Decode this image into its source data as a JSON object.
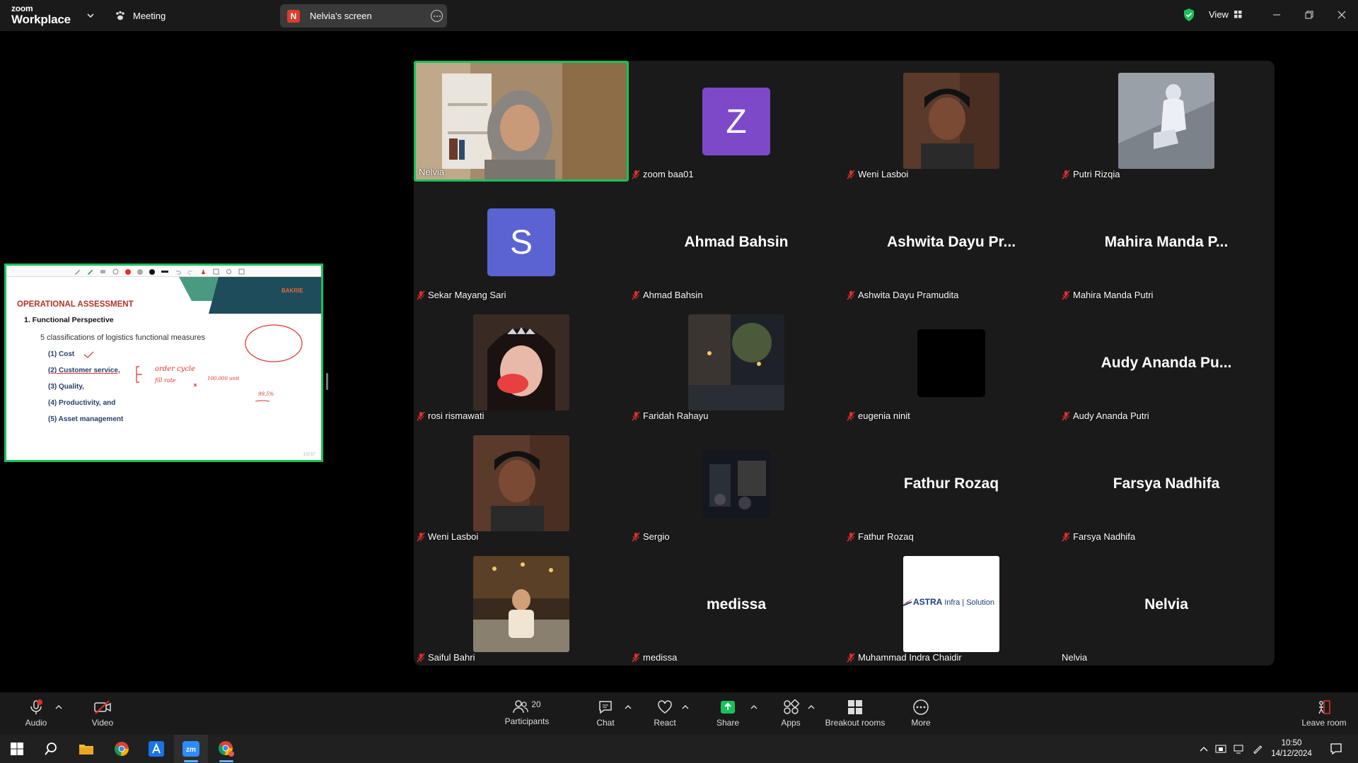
{
  "titlebar": {
    "logo_line1": "zoom",
    "logo_line2": "Workplace",
    "meeting_label": "Meeting",
    "screen_pill_initial": "N",
    "screen_pill_label": "Nelvia's screen",
    "view_label": "View"
  },
  "shared_slide": {
    "title": "OPERATIONAL ASSESSMENT",
    "heading": "1. Functional Perspective",
    "subheading": "5 classifications of logistics functional measures",
    "items": [
      "(1) Cost",
      "(2) Customer service,",
      "(3) Quality,",
      "(4) Productivity, and",
      "(5) Asset management"
    ],
    "brand": "BAKRIE",
    "handwriting": [
      "order cycle",
      "fill rate",
      "100.000 unit",
      "99.5%"
    ],
    "page": "10/37"
  },
  "participants": [
    {
      "name": "Nelvia",
      "muted": false,
      "kind": "video",
      "active": true
    },
    {
      "name": "zoom baa01",
      "muted": true,
      "kind": "avatar",
      "initial": "Z",
      "color": "#7d49c9"
    },
    {
      "name": "Weni Lasboi",
      "muted": true,
      "kind": "photo"
    },
    {
      "name": "Putri Rizqia",
      "muted": true,
      "kind": "photo"
    },
    {
      "name": "Sekar Mayang Sari",
      "muted": true,
      "kind": "avatar",
      "initial": "S",
      "color": "#5b63d3"
    },
    {
      "name": "Ahmad Bahsin",
      "muted": true,
      "kind": "text",
      "display": "Ahmad Bahsin"
    },
    {
      "name": "Ashwita Dayu Pramudita",
      "muted": true,
      "kind": "text",
      "display": "Ashwita Dayu Pr..."
    },
    {
      "name": "Mahira Manda Putri",
      "muted": true,
      "kind": "text",
      "display": "Mahira Manda P..."
    },
    {
      "name": "rosi rismawati",
      "muted": true,
      "kind": "photo"
    },
    {
      "name": "Faridah Rahayu",
      "muted": true,
      "kind": "photo"
    },
    {
      "name": "eugenia ninit",
      "muted": true,
      "kind": "black"
    },
    {
      "name": "Audy Ananda Putri",
      "muted": true,
      "kind": "text",
      "display": "Audy Ananda Pu..."
    },
    {
      "name": "Weni Lasboi",
      "muted": true,
      "kind": "photo"
    },
    {
      "name": "Sergio",
      "muted": true,
      "kind": "photo"
    },
    {
      "name": "Fathur Rozaq",
      "muted": true,
      "kind": "text",
      "display": "Fathur Rozaq"
    },
    {
      "name": "Farsya Nadhifa",
      "muted": true,
      "kind": "text",
      "display": "Farsya Nadhifa"
    },
    {
      "name": "Saiful Bahri",
      "muted": true,
      "kind": "photo"
    },
    {
      "name": "medissa",
      "muted": true,
      "kind": "text",
      "display": "medissa"
    },
    {
      "name": "Muhammad Indra Chaidir",
      "muted": true,
      "kind": "logo",
      "logo_text": "ASTRA",
      "logo_sub": "Infra | Solution"
    },
    {
      "name": "Nelvia",
      "muted": false,
      "kind": "text",
      "display": "Nelvia"
    }
  ],
  "controls": {
    "audio": "Audio",
    "video": "Video",
    "participants": "Participants",
    "participants_count": "20",
    "chat": "Chat",
    "react": "React",
    "share": "Share",
    "apps": "Apps",
    "breakout": "Breakout rooms",
    "more": "More",
    "leave": "Leave room"
  },
  "taskbar": {
    "time": "10:50",
    "date": "14/12/2024"
  },
  "colors": {
    "active_speaker": "#19c15a",
    "muted_red": "#e02f2f",
    "share_green": "#19c15a"
  }
}
